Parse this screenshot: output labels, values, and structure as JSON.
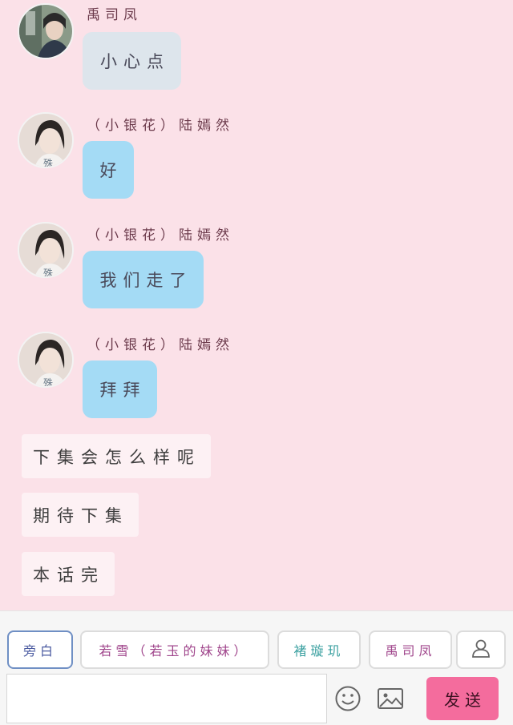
{
  "messages": [
    {
      "sender": "禹司凤",
      "text": "小心点"
    },
    {
      "sender": "（小银花）陆嫣然",
      "text": "好"
    },
    {
      "sender": "（小银花）陆嫣然",
      "text": "我们走了"
    },
    {
      "sender": "（小银花）陆嫣然",
      "text": "拜拜"
    }
  ],
  "narration": [
    "下集会怎么样呢",
    "期待下集",
    "本话完"
  ],
  "roles": [
    "旁白",
    "若雪（若玉的妹妹）",
    "褚璇玑",
    "禹司凤"
  ],
  "input": {
    "value": "",
    "placeholder": ""
  },
  "send_label": "发送",
  "colors": {
    "background": "#fbe1e8",
    "bubble_blue": "#a4dbf5",
    "bubble_grey": "#dde5ec",
    "send": "#f46c9d"
  },
  "icons": [
    "user-icon",
    "emoji-icon",
    "image-icon"
  ]
}
